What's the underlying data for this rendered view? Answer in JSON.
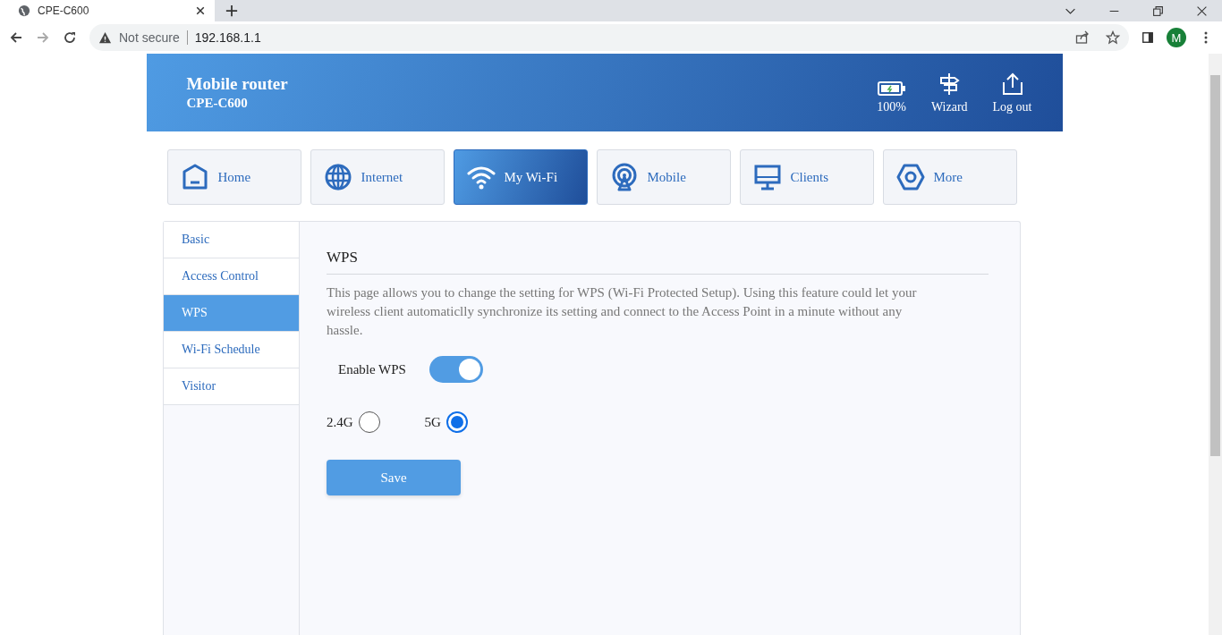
{
  "browser": {
    "tab_title": "CPE-C600",
    "security": "Not secure",
    "url": "192.168.1.1",
    "profile": "M"
  },
  "header": {
    "title": "Mobile router",
    "model": "CPE-C600",
    "battery": "100%",
    "actions": [
      "Wizard",
      "Log out"
    ]
  },
  "nav": [
    {
      "label": "Home",
      "selected": false
    },
    {
      "label": "Internet",
      "selected": false
    },
    {
      "label": "My Wi-Fi",
      "selected": true
    },
    {
      "label": "Mobile",
      "selected": false
    },
    {
      "label": "Clients",
      "selected": false
    },
    {
      "label": "More",
      "selected": false
    }
  ],
  "sidebar": {
    "items": [
      {
        "label": "Basic",
        "selected": false
      },
      {
        "label": "Access Control",
        "selected": false
      },
      {
        "label": "WPS",
        "selected": true
      },
      {
        "label": "Wi-Fi Schedule",
        "selected": false
      },
      {
        "label": "Visitor",
        "selected": false
      }
    ]
  },
  "content": {
    "title": "WPS",
    "description": "This page allows you to change the setting for WPS (Wi-Fi Protected Setup). Using this feature could let your wireless client automaticlly synchronize its setting and connect to the Access Point in a minute without any hassle.",
    "enable": {
      "label": "Enable WPS",
      "on": true
    },
    "bands": [
      {
        "label": "2.4G",
        "selected": false
      },
      {
        "label": "5G",
        "selected": true
      }
    ],
    "save": "Save"
  }
}
